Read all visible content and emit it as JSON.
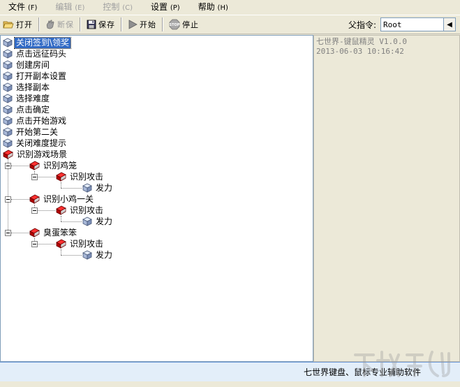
{
  "menu": {
    "items": [
      {
        "label": "文件",
        "key": "(F)",
        "disabled": false
      },
      {
        "label": "编辑",
        "key": "(E)",
        "disabled": true
      },
      {
        "label": "控制",
        "key": "(C)",
        "disabled": true
      },
      {
        "label": "设置",
        "key": "(P)",
        "disabled": false
      },
      {
        "label": "帮助",
        "key": "(H)",
        "disabled": false
      }
    ]
  },
  "toolbar": {
    "open_label": "打开",
    "disconnect_label": "断保",
    "save_label": "保存",
    "start_label": "开始",
    "stop_label": "停止",
    "stop_icon_text": "STOP",
    "parent_label": "父指令:",
    "parent_value": "Root"
  },
  "tree": {
    "nodes": [
      {
        "label": "关闭签到\\领奖",
        "icon": "cube",
        "selected": true
      },
      {
        "label": "点击远征码头",
        "icon": "cube"
      },
      {
        "label": "创建房间",
        "icon": "cube"
      },
      {
        "label": "打开副本设置",
        "icon": "cube"
      },
      {
        "label": "选择副本",
        "icon": "cube"
      },
      {
        "label": "选择难度",
        "icon": "cube"
      },
      {
        "label": "点击确定",
        "icon": "cube"
      },
      {
        "label": "点击开始游戏",
        "icon": "cube"
      },
      {
        "label": "开始第二关",
        "icon": "cube"
      },
      {
        "label": "关闭难度提示",
        "icon": "cube"
      },
      {
        "label": "识别游戏场景",
        "icon": "book"
      },
      {
        "label": "识别鸡笼",
        "icon": "book"
      },
      {
        "label": "识别攻击",
        "icon": "book"
      },
      {
        "label": "发力",
        "icon": "cube"
      },
      {
        "label": "识别小鸡一关",
        "icon": "book"
      },
      {
        "label": "识别攻击",
        "icon": "book"
      },
      {
        "label": "发力",
        "icon": "cube"
      },
      {
        "label": "臭蛋笨笨",
        "icon": "book"
      },
      {
        "label": "识别攻击",
        "icon": "book"
      },
      {
        "label": "发力",
        "icon": "cube"
      }
    ]
  },
  "info": {
    "title": "七世界-键鼠精灵  V1.0.0",
    "datetime": "2013-06-03   10:16:42"
  },
  "status": {
    "text": "七世界键盘、鼠标专业辅助软件"
  },
  "icons": {
    "cube": "cube-icon",
    "book": "red-book-icon",
    "open": "folder-open-icon",
    "disconnect": "hand-icon",
    "save": "floppy-disk-icon",
    "start": "play-icon",
    "stop": "stop-sign-icon"
  },
  "colors": {
    "selection": "#316ac5",
    "book_red": "#cc0000",
    "status_bg": "#e3eef9"
  }
}
